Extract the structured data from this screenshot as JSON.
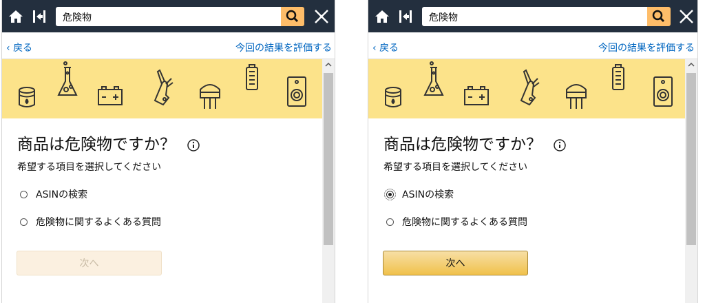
{
  "panels": [
    {
      "search": {
        "value": "危険物"
      },
      "nav": {
        "back_label": "戻る",
        "rate_label": "今回の結果を評価する"
      },
      "question": {
        "heading": "商品は危険物ですか？",
        "instruction": "希望する項目を選択してください"
      },
      "options": [
        {
          "label": "ASINの検索",
          "selected": false
        },
        {
          "label": "危険物に関するよくある質問",
          "selected": false
        }
      ],
      "next_button": {
        "label": "次へ",
        "state": "disabled"
      }
    },
    {
      "search": {
        "value": "危険物"
      },
      "nav": {
        "back_label": "戻る",
        "rate_label": "今回の結果を評価する"
      },
      "question": {
        "heading": "商品は危険物ですか？",
        "instruction": "希望する項目を選択してください"
      },
      "options": [
        {
          "label": "ASINの検索",
          "selected": true
        },
        {
          "label": "危険物に関するよくある質問",
          "selected": false
        }
      ],
      "next_button": {
        "label": "次へ",
        "state": "enabled"
      }
    }
  ],
  "icons": [
    "home-icon",
    "collapse-icon",
    "search-icon",
    "close-icon",
    "info-icon",
    "oil-barrel-icon",
    "flask-icon",
    "battery-icon",
    "multitool-icon",
    "transistor-icon",
    "battery-cell-icon",
    "speaker-icon"
  ],
  "colors": {
    "topbar": "#232f3e",
    "search_button": "#febd69",
    "banner": "#fce38a",
    "link": "#0066c0",
    "button_enabled": "#f0c14b"
  }
}
